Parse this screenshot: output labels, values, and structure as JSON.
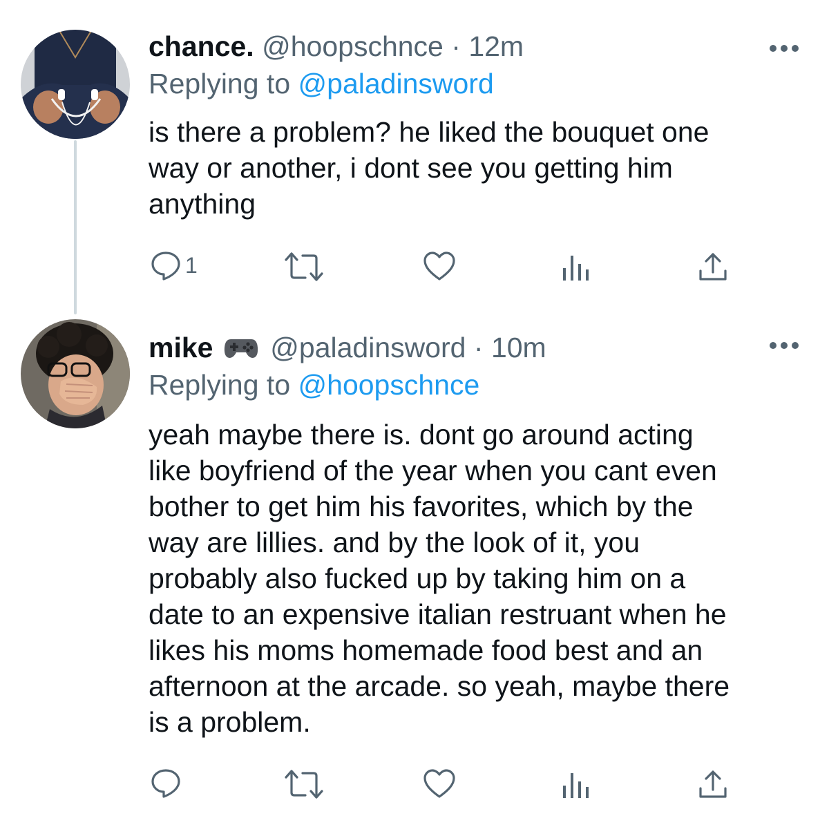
{
  "tweets": [
    {
      "display_name": "chance.",
      "handle": "@hoopschnce",
      "separator": "·",
      "time": "12m",
      "replying_prefix": "Replying to",
      "replying_to": "@paladinsword",
      "text": "is there a problem? he liked the bouquet one\nway or another, i dont see you getting him\nanything",
      "reply_count": "1",
      "avatar": "avatar-photo"
    },
    {
      "display_name": "mike",
      "name_emoji": "video-game-controller-icon",
      "handle": "@paladinsword",
      "separator": "·",
      "time": "10m",
      "replying_prefix": "Replying to",
      "replying_to": "@hoopschnce",
      "text": "yeah maybe there is. dont go around acting\nlike boyfriend of the year when you cant even\nbother to get him his favorites, which by the\nway are lillies. and by the look of it, you\nprobably also fucked up by taking him on a\ndate to an expensive italian restruant when he\nlikes his moms homemade food best and an\nafternoon at the arcade. so yeah, maybe there\nis a problem.",
      "reply_count": "",
      "avatar": "avatar-photo"
    }
  ],
  "colors": {
    "text": "#0f1419",
    "secondary": "#536471",
    "link": "#1d9bf0",
    "thread_line": "#cfd9de"
  },
  "icons": [
    "reply-icon",
    "retweet-icon",
    "like-icon",
    "analytics-icon",
    "share-icon",
    "more-options-icon"
  ]
}
